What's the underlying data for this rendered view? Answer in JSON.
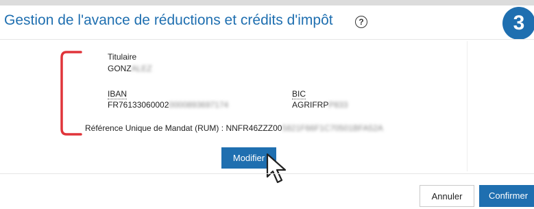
{
  "dialog": {
    "title": "Gestion de l'avance de réductions et crédits d'impôt",
    "help_icon": "question-circle-icon",
    "step_number": "3"
  },
  "account": {
    "titulaire_label": "Titulaire",
    "titulaire_value_visible": "GONZ",
    "titulaire_value_blurred": "ALEZ",
    "iban_label": "IBAN",
    "iban_value_visible": "FR76133060002",
    "iban_value_blurred": "0000893697174",
    "bic_label": "BIC",
    "bic_value_visible": "AGRIFRP",
    "bic_value_blurred": "P833",
    "rum_label": "Référence Unique de Mandat (RUM) : ",
    "rum_value_visible": "NNFR46ZZZ00",
    "rum_value_blurred": "5821F66F1C70501BFA52A"
  },
  "actions": {
    "modifier_label": "Modifier",
    "annuler_label": "Annuler",
    "confirmer_label": "Confirmer"
  },
  "colors": {
    "brand_blue": "#1f6fb0",
    "bracket_red": "#e0343a"
  }
}
